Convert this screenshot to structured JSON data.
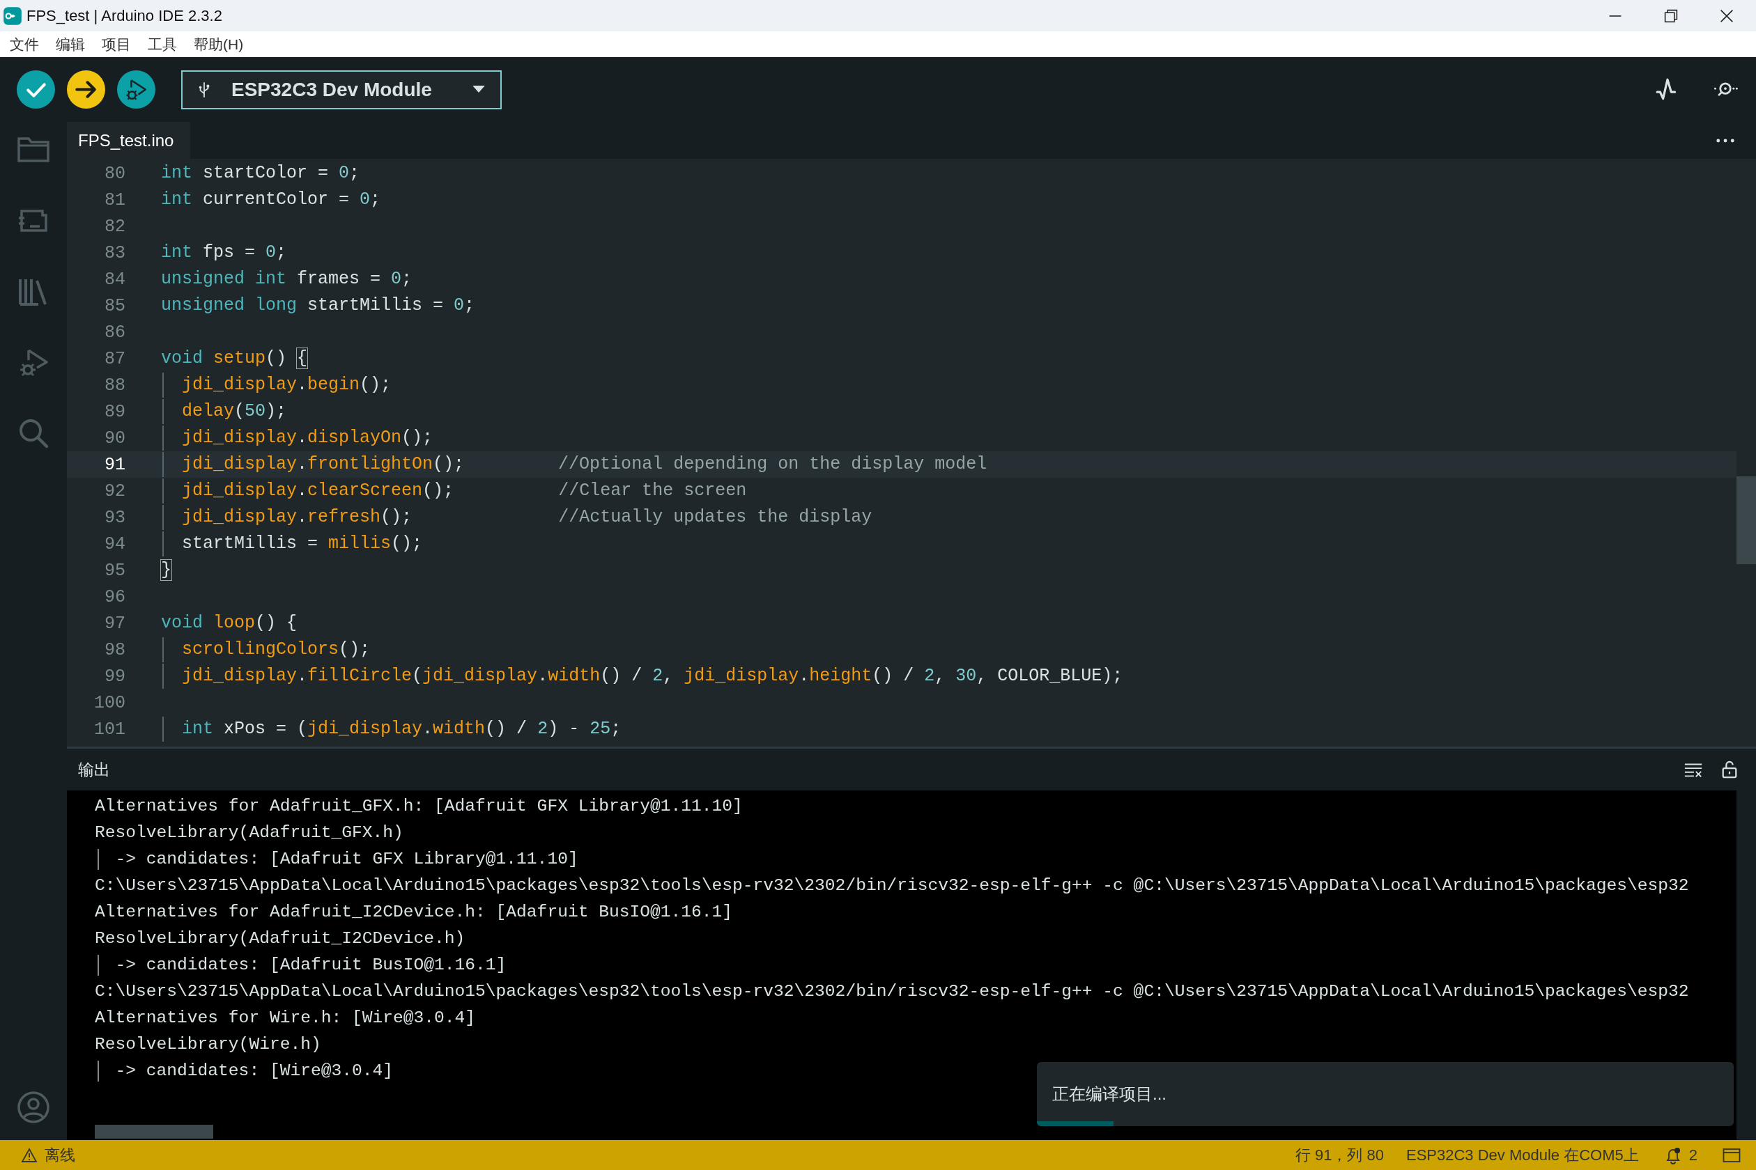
{
  "window": {
    "title": "FPS_test | Arduino IDE 2.3.2"
  },
  "menu": [
    "文件",
    "编辑",
    "项目",
    "工具",
    "帮助(H)"
  ],
  "toolbar": {
    "board": "ESP32C3 Dev Module"
  },
  "tabs": [
    {
      "label": "FPS_test.ino",
      "selected": true
    }
  ],
  "editor": {
    "lines": [
      {
        "number": "80",
        "current": false,
        "indented": false,
        "tokens": [
          {
            "kind": "kw",
            "text": "int"
          },
          {
            "kind": "plain",
            "text": " startColor = "
          },
          {
            "kind": "num",
            "text": "0"
          },
          {
            "kind": "plain",
            "text": ";"
          }
        ]
      },
      {
        "number": "81",
        "current": false,
        "indented": false,
        "tokens": [
          {
            "kind": "kw",
            "text": "int"
          },
          {
            "kind": "plain",
            "text": " currentColor = "
          },
          {
            "kind": "num",
            "text": "0"
          },
          {
            "kind": "plain",
            "text": ";"
          }
        ]
      },
      {
        "number": "82",
        "current": false
      },
      {
        "number": "83",
        "current": false,
        "indented": false,
        "tokens": [
          {
            "kind": "kw",
            "text": "int"
          },
          {
            "kind": "plain",
            "text": " fps = "
          },
          {
            "kind": "num",
            "text": "0"
          },
          {
            "kind": "plain",
            "text": ";"
          }
        ]
      },
      {
        "number": "84",
        "current": false,
        "indented": false,
        "tokens": [
          {
            "kind": "kw",
            "text": "unsigned int"
          },
          {
            "kind": "plain",
            "text": " frames = "
          },
          {
            "kind": "num",
            "text": "0"
          },
          {
            "kind": "plain",
            "text": ";"
          }
        ]
      },
      {
        "number": "85",
        "current": false,
        "indented": false,
        "tokens": [
          {
            "kind": "kw",
            "text": "unsigned long"
          },
          {
            "kind": "plain",
            "text": " startMillis = "
          },
          {
            "kind": "num",
            "text": "0"
          },
          {
            "kind": "plain",
            "text": ";"
          }
        ]
      },
      {
        "number": "86",
        "current": false
      },
      {
        "number": "87",
        "current": false,
        "indented": false,
        "tokens": [
          {
            "kind": "kw",
            "text": "void "
          },
          {
            "kind": "fn",
            "text": "setup"
          },
          {
            "kind": "plain",
            "text": "() "
          },
          {
            "kind": "match",
            "text": "{"
          }
        ]
      },
      {
        "number": "88",
        "current": false,
        "indented": true,
        "tokens": [
          {
            "kind": "fn",
            "text": "jdi_display"
          },
          {
            "kind": "plain",
            "text": "."
          },
          {
            "kind": "fn",
            "text": "begin"
          },
          {
            "kind": "plain",
            "text": "();"
          }
        ]
      },
      {
        "number": "89",
        "current": false,
        "indented": true,
        "tokens": [
          {
            "kind": "fn",
            "text": "delay"
          },
          {
            "kind": "plain",
            "text": "("
          },
          {
            "kind": "num",
            "text": "50"
          },
          {
            "kind": "plain",
            "text": ");"
          }
        ]
      },
      {
        "number": "90",
        "current": false,
        "indented": true,
        "tokens": [
          {
            "kind": "fn",
            "text": "jdi_display"
          },
          {
            "kind": "plain",
            "text": "."
          },
          {
            "kind": "fn",
            "text": "displayOn"
          },
          {
            "kind": "plain",
            "text": "();"
          }
        ]
      },
      {
        "number": "91",
        "current": true,
        "indented": true,
        "tokens": [
          {
            "kind": "fn",
            "text": "jdi_display"
          },
          {
            "kind": "plain",
            "text": "."
          },
          {
            "kind": "fn",
            "text": "frontlightOn"
          },
          {
            "kind": "plain",
            "text": "();         "
          },
          {
            "kind": "comment",
            "text": "//Optional depending on the display model"
          }
        ]
      },
      {
        "number": "92",
        "current": false,
        "indented": true,
        "tokens": [
          {
            "kind": "fn",
            "text": "jdi_display"
          },
          {
            "kind": "plain",
            "text": "."
          },
          {
            "kind": "fn",
            "text": "clearScreen"
          },
          {
            "kind": "plain",
            "text": "();          "
          },
          {
            "kind": "comment",
            "text": "//Clear the screen"
          }
        ]
      },
      {
        "number": "93",
        "current": false,
        "indented": true,
        "tokens": [
          {
            "kind": "fn",
            "text": "jdi_display"
          },
          {
            "kind": "plain",
            "text": "."
          },
          {
            "kind": "fn",
            "text": "refresh"
          },
          {
            "kind": "plain",
            "text": "();              "
          },
          {
            "kind": "comment",
            "text": "//Actually updates the display"
          }
        ]
      },
      {
        "number": "94",
        "current": false,
        "indented": true,
        "tokens": [
          {
            "kind": "plain",
            "text": "startMillis = "
          },
          {
            "kind": "fn",
            "text": "millis"
          },
          {
            "kind": "plain",
            "text": "();"
          }
        ]
      },
      {
        "number": "95",
        "current": false,
        "indented": false,
        "tokens": [
          {
            "kind": "match",
            "text": "}"
          }
        ]
      },
      {
        "number": "96",
        "current": false
      },
      {
        "number": "97",
        "current": false,
        "indented": false,
        "tokens": [
          {
            "kind": "kw",
            "text": "void "
          },
          {
            "kind": "fn",
            "text": "loop"
          },
          {
            "kind": "plain",
            "text": "() {"
          }
        ]
      },
      {
        "number": "98",
        "current": false,
        "indented": true,
        "tokens": [
          {
            "kind": "fn",
            "text": "scrollingColors"
          },
          {
            "kind": "plain",
            "text": "();"
          }
        ]
      },
      {
        "number": "99",
        "current": false,
        "indented": true,
        "tokens": [
          {
            "kind": "fn",
            "text": "jdi_display"
          },
          {
            "kind": "plain",
            "text": "."
          },
          {
            "kind": "fn",
            "text": "fillCircle"
          },
          {
            "kind": "plain",
            "text": "("
          },
          {
            "kind": "fn",
            "text": "jdi_display"
          },
          {
            "kind": "plain",
            "text": "."
          },
          {
            "kind": "fn",
            "text": "width"
          },
          {
            "kind": "plain",
            "text": "() / "
          },
          {
            "kind": "num",
            "text": "2"
          },
          {
            "kind": "plain",
            "text": ", "
          },
          {
            "kind": "fn",
            "text": "jdi_display"
          },
          {
            "kind": "plain",
            "text": "."
          },
          {
            "kind": "fn",
            "text": "height"
          },
          {
            "kind": "plain",
            "text": "() / "
          },
          {
            "kind": "num",
            "text": "2"
          },
          {
            "kind": "plain",
            "text": ", "
          },
          {
            "kind": "num",
            "text": "30"
          },
          {
            "kind": "plain",
            "text": ", COLOR_BLUE);"
          }
        ]
      },
      {
        "number": "100",
        "current": false
      },
      {
        "number": "101",
        "current": false,
        "indented": true,
        "tokens": [
          {
            "kind": "kw",
            "text": "int"
          },
          {
            "kind": "plain",
            "text": " xPos = ("
          },
          {
            "kind": "fn",
            "text": "jdi_display"
          },
          {
            "kind": "plain",
            "text": "."
          },
          {
            "kind": "fn",
            "text": "width"
          },
          {
            "kind": "plain",
            "text": "() / "
          },
          {
            "kind": "num",
            "text": "2"
          },
          {
            "kind": "plain",
            "text": ") - "
          },
          {
            "kind": "num",
            "text": "25"
          },
          {
            "kind": "plain",
            "text": ";"
          }
        ]
      }
    ]
  },
  "output": {
    "title": "输出",
    "lines": [
      "Alternatives for Adafruit_GFX.h: [Adafruit GFX Library@1.11.10]",
      "ResolveLibrary(Adafruit_GFX.h)",
      "  -> candidates: [Adafruit GFX Library@1.11.10]",
      "C:\\Users\\23715\\AppData\\Local\\Arduino15\\packages\\esp32\\tools\\esp-rv32\\2302/bin/riscv32-esp-elf-g++ -c @C:\\Users\\23715\\AppData\\Local\\Arduino15\\packages\\esp32",
      "Alternatives for Adafruit_I2CDevice.h: [Adafruit BusIO@1.16.1]",
      "ResolveLibrary(Adafruit_I2CDevice.h)",
      "  -> candidates: [Adafruit BusIO@1.16.1]",
      "C:\\Users\\23715\\AppData\\Local\\Arduino15\\packages\\esp32\\tools\\esp-rv32\\2302/bin/riscv32-esp-elf-g++ -c @C:\\Users\\23715\\AppData\\Local\\Arduino15\\packages\\esp32",
      "Alternatives for Wire.h: [Wire@3.0.4]",
      "ResolveLibrary(Wire.h)",
      "  -> candidates: [Wire@3.0.4]"
    ]
  },
  "toast": {
    "message": "正在编译项目...",
    "level": 0.11
  },
  "status_bar": {
    "status": "离线",
    "position": "行 91，列 80",
    "board_port": "ESP32C3 Dev Module 在COM5上",
    "notification_count": "2"
  }
}
